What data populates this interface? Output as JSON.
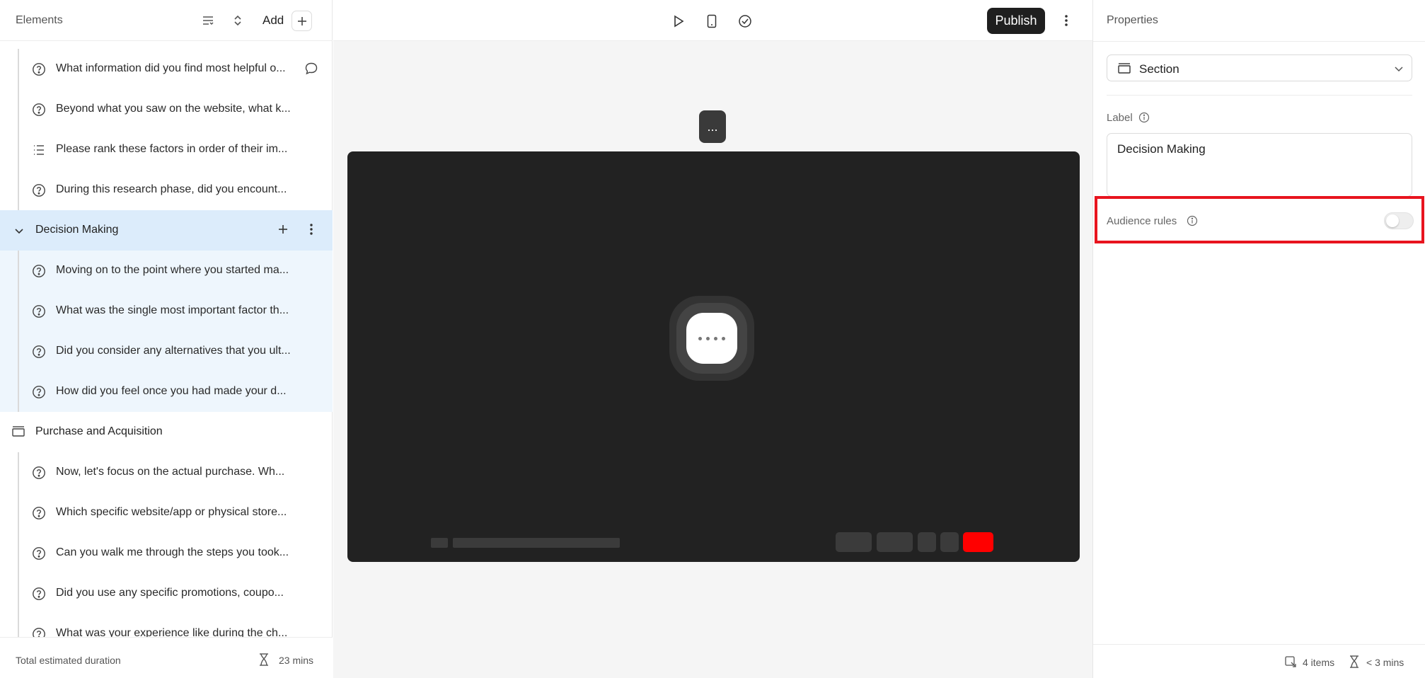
{
  "left_panel": {
    "title": "Elements",
    "add_label": "Add",
    "footer_label": "Total estimated duration",
    "footer_duration": "23 mins"
  },
  "tree": {
    "rows": [
      {
        "kind": "question",
        "icon": "question-circle-icon",
        "text": "What information did you find most helpful o...",
        "comment": true
      },
      {
        "kind": "question",
        "icon": "question-circle-icon",
        "text": "Beyond what you saw on the website, what k..."
      },
      {
        "kind": "question",
        "icon": "ranking-list-icon",
        "text": "Please rank these factors in order of their im..."
      },
      {
        "kind": "question",
        "icon": "question-circle-icon",
        "text": "During this research phase, did you encount..."
      },
      {
        "kind": "section",
        "text": "Decision Making",
        "expanded": true,
        "selected": true
      },
      {
        "kind": "question",
        "icon": "question-circle-icon",
        "text": "Moving on to the point where you started ma...",
        "in_selected": true
      },
      {
        "kind": "question",
        "icon": "question-circle-icon",
        "text": "What was the single most important factor th...",
        "in_selected": true
      },
      {
        "kind": "question",
        "icon": "question-circle-icon",
        "text": "Did you consider any alternatives that you ult...",
        "in_selected": true
      },
      {
        "kind": "question",
        "icon": "question-circle-icon",
        "text": "How did you feel once you had made your d...",
        "in_selected": true
      },
      {
        "kind": "section",
        "text": "Purchase and Acquisition",
        "expanded": false
      },
      {
        "kind": "question",
        "icon": "question-circle-icon",
        "text": "Now, let's focus on the actual purchase. Wh..."
      },
      {
        "kind": "question",
        "icon": "question-circle-icon",
        "text": "Which specific website/app or physical store..."
      },
      {
        "kind": "question",
        "icon": "question-circle-icon",
        "text": "Can you walk me through the steps you took..."
      },
      {
        "kind": "question",
        "icon": "question-circle-icon",
        "text": "Did you use any specific promotions, coupo..."
      },
      {
        "kind": "question",
        "icon": "question-circle-icon",
        "text": "What was your experience like during the ch..."
      }
    ]
  },
  "toolbar": {
    "publish_label": "Publish",
    "floating_menu": "..."
  },
  "right_panel": {
    "title": "Properties",
    "section_type": "Section",
    "label_title": "Label",
    "label_value": "Decision Making",
    "audience_rules_label": "Audience rules",
    "audience_rules_enabled": false,
    "footer_items": "4 items",
    "footer_duration": "< 3 mins"
  },
  "colors": {
    "highlight": "#e8141e",
    "preview_bg": "#222222",
    "record_button": "#ff0000",
    "selected_section_bg": "#dcecfb",
    "selected_child_bg": "#eef6fd"
  }
}
